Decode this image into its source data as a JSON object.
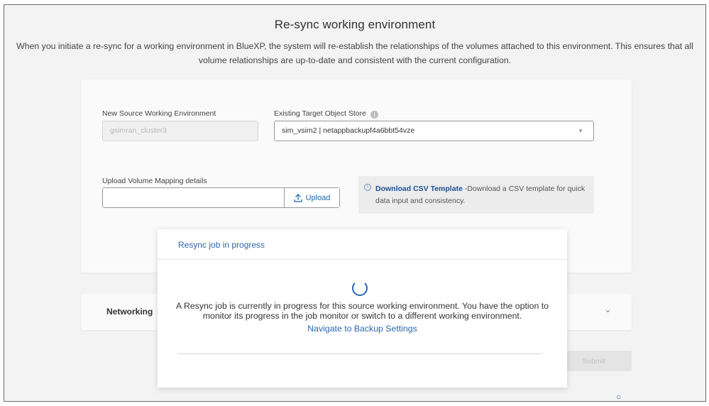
{
  "page": {
    "title": "Re-sync working environment",
    "description": "When you initiate a re-sync for a working environment in BlueXP, the system will re-establish the relationships of the volumes attached to this environment. This ensures that all volume relationships are up-to-date and consistent with the current configuration."
  },
  "form": {
    "source_label": "New Source Working Environment",
    "source_value": "gsimran_cluster3",
    "target_label": "Existing Target Object Store",
    "target_value": "sim_vsim2 | netappbackupf4a6bbt54vze",
    "upload_label": "Upload Volume Mapping details",
    "upload_value": "",
    "upload_button": "Upload",
    "csv_link": "Download CSV Template",
    "csv_text": " -Download a CSV template for quick data input and consistency."
  },
  "networking": {
    "title": "Networking"
  },
  "actions": {
    "submit_label": "Submit"
  },
  "modal": {
    "title": "Resync job in progress",
    "message": "A Resync job is currently in progress for this source working environment. You have the option to monitor its progress in the job monitor or switch to a different working environment.",
    "link": "Navigate to Backup Settings"
  },
  "icons": {
    "info": "info-icon",
    "upload": "upload-icon",
    "dropdown": "chevron-down-icon",
    "spinner": "loading-spinner-icon"
  },
  "colors": {
    "accent": "#2d67b0",
    "link_dark": "#1d4f91",
    "background": "#f3f3f3",
    "card": "#fafafa"
  }
}
